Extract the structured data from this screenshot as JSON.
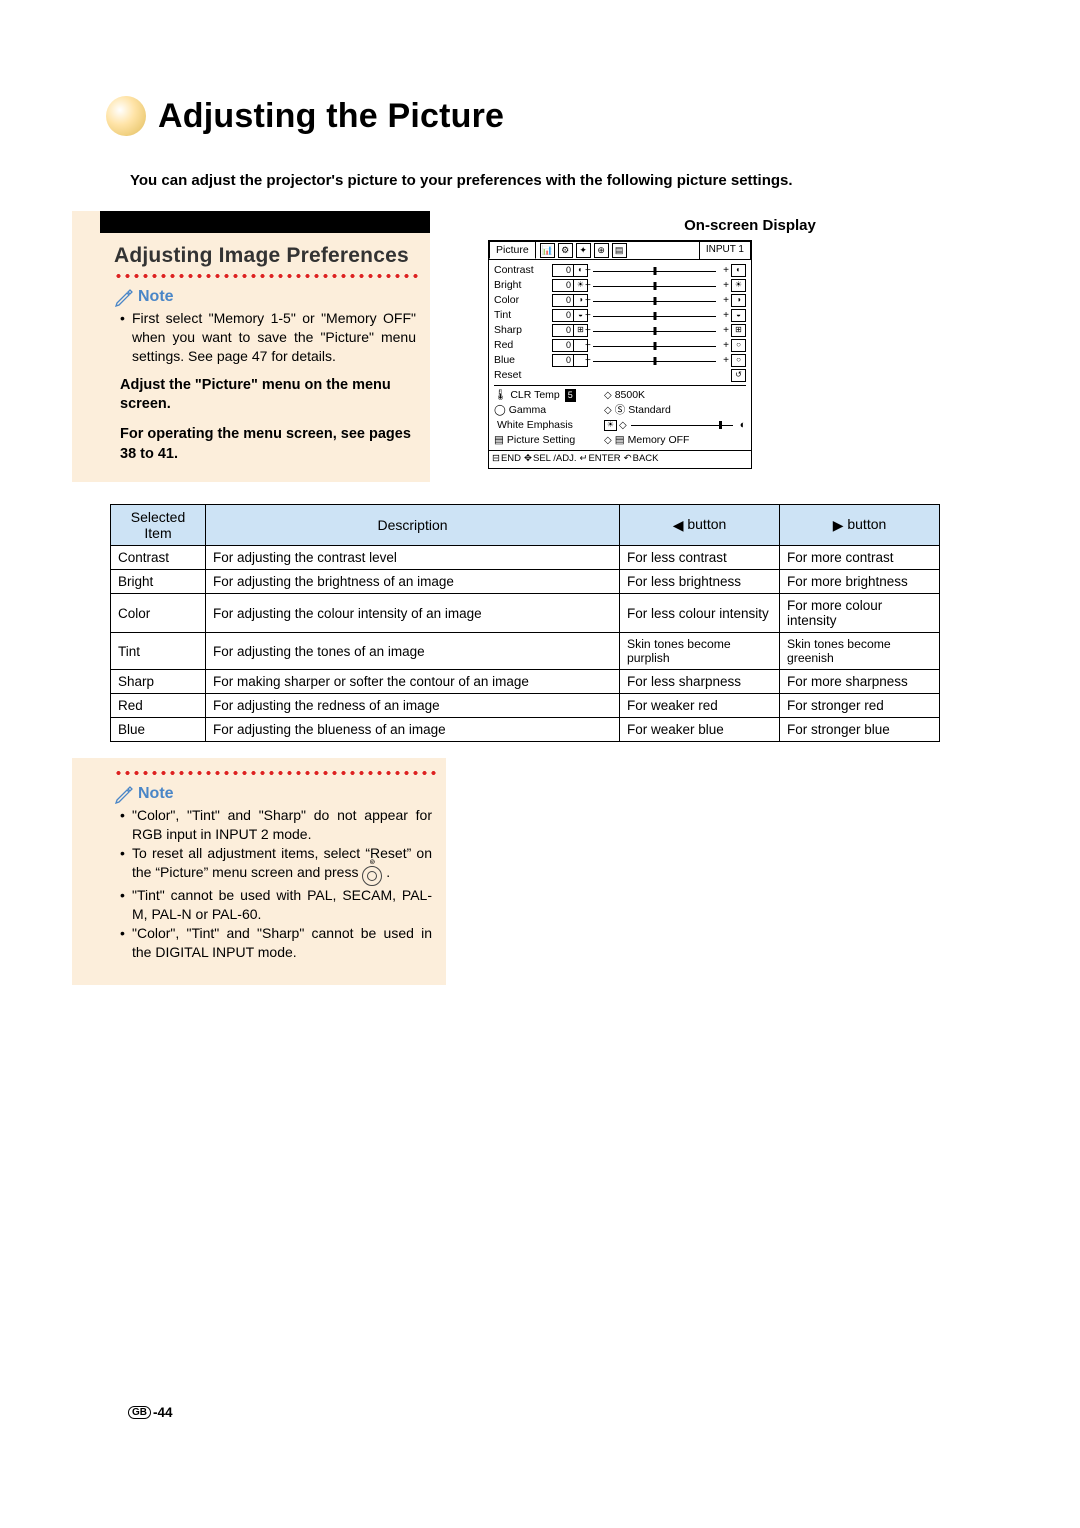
{
  "page_title": "Adjusting the Picture",
  "intro": "You can adjust the projector's picture to your preferences with the following picture settings.",
  "section_heading": "Adjusting Image Preferences",
  "note_label": "Note",
  "note1_items": [
    "First select \"Memory 1-5\" or \"Memory OFF\" when you want to save the \"Picture\" menu settings. See page 47 for details."
  ],
  "instruction": {
    "line1": "Adjust the \"Picture\" menu on the menu screen.",
    "line2": "For operating the menu screen, see pages 38 to 41."
  },
  "osd_title": "On-screen Display",
  "osd": {
    "active_tab": "Picture",
    "input": "INPUT 1",
    "sliders": [
      {
        "label": "Contrast",
        "val": "0",
        "icon": "◐"
      },
      {
        "label": "Bright",
        "val": "0",
        "icon": "☀"
      },
      {
        "label": "Color",
        "val": "0",
        "icon": "◑"
      },
      {
        "label": "Tint",
        "val": "0",
        "icon": "◒"
      },
      {
        "label": "Sharp",
        "val": "0",
        "icon": "⊞"
      },
      {
        "label": "Red",
        "val": "0",
        "icon": ""
      },
      {
        "label": "Blue",
        "val": "0",
        "icon": ""
      }
    ],
    "reset": "Reset",
    "options": [
      {
        "icon": "🌡",
        "label": "CLR Temp",
        "badge": "5",
        "value": "8500K"
      },
      {
        "icon": "◯",
        "label": "Gamma",
        "value_icon": "Ⓢ",
        "value": "Standard"
      },
      {
        "icon": "",
        "label": "White Emphasis",
        "slider": true
      },
      {
        "icon": "▤",
        "label": "Picture Setting",
        "value_icon": "▤",
        "value": "Memory OFF"
      }
    ],
    "footer": [
      "END",
      "SEL /ADJ.",
      "ENTER",
      "BACK"
    ]
  },
  "table": {
    "headers": [
      "Selected Item",
      "Description",
      "◀ button",
      "▶ button"
    ],
    "rows": [
      [
        "Contrast",
        "For adjusting the contrast level",
        "For less contrast",
        "For more contrast"
      ],
      [
        "Bright",
        "For adjusting the brightness of an image",
        "For less brightness",
        "For more brightness"
      ],
      [
        "Color",
        "For adjusting the colour intensity of an image",
        "For less colour intensity",
        "For more colour intensity"
      ],
      [
        "Tint",
        "For adjusting the tones of an image",
        "Skin tones become purplish",
        "Skin tones become greenish"
      ],
      [
        "Sharp",
        "For making sharper or softer the contour of an image",
        "For less sharpness",
        "For more sharpness"
      ],
      [
        "Red",
        "For adjusting the redness of an image",
        "For weaker red",
        "For stronger red"
      ],
      [
        "Blue",
        "For adjusting the blueness of an image",
        "For weaker blue",
        "For stronger blue"
      ]
    ]
  },
  "note2_items": [
    "\"Color\", \"Tint\" and \"Sharp\" do not appear for RGB input in INPUT 2 mode.",
    "To reset all adjustment items, select \"Reset\" on the \"Picture\" menu screen and press ⊚.",
    "\"Tint\" cannot be used with PAL, SECAM, PAL-M, PAL-N or PAL-60.",
    "\"Color\", \"Tint\" and \"Sharp\" cannot be used in the DIGITAL INPUT mode."
  ],
  "page_number": "-44",
  "gb": "GB"
}
